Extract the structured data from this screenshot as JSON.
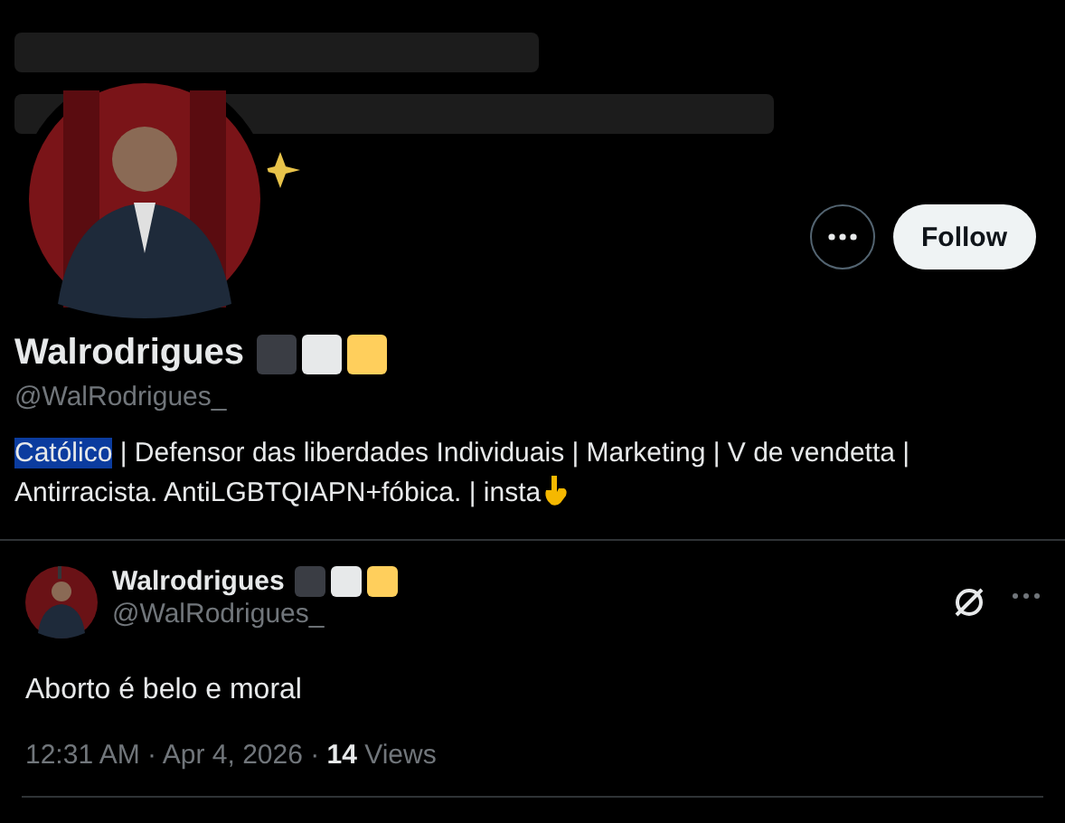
{
  "profile": {
    "name": "Walrodrigues",
    "badges": [
      {
        "color": "#3a3d44"
      },
      {
        "color": "#e7e9ea"
      },
      {
        "color": "#ffcf5c"
      }
    ],
    "handle": "@WalRodrigues_",
    "bio": [
      {
        "text": "Católico",
        "selected": true
      },
      {
        "text": " | Defensor das liberdades Individuais | Marketing | V de vendetta | Antirracista. AntiLGBTQIAPN+fóbica. | insta",
        "selected": false
      }
    ],
    "follow_label": "Follow"
  },
  "post": {
    "name": "Walrodrigues",
    "badges": [
      {
        "color": "#3a3d44"
      },
      {
        "color": "#e7e9ea"
      },
      {
        "color": "#ffcf5c"
      }
    ],
    "handle": "@WalRodrigues_",
    "text": "Aborto é belo e moral",
    "time": "12:31 AM · Apr 4, 2026 · ",
    "views_count": "14",
    "views_label": " Views"
  }
}
